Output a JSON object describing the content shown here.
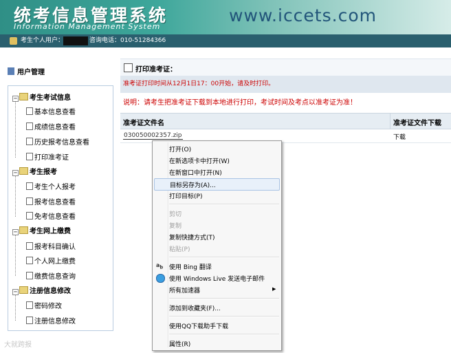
{
  "banner": {
    "title": "统考信息管理系统",
    "subtitle": "Information Management System",
    "url": "www.iccets.com"
  },
  "infobar": {
    "user_label": "考生个人用户：",
    "phone_label": "咨询电话：010-51284366"
  },
  "sidebar": {
    "title": "用户管理",
    "groups": [
      {
        "label": "考生考试信息",
        "items": [
          "基本信息查看",
          "成绩信息查看",
          "历史报考信息查看",
          "打印准考证"
        ]
      },
      {
        "label": "考生报考",
        "items": [
          "考生个人报考",
          "报考信息查看",
          "免考信息查看"
        ]
      },
      {
        "label": "考生网上缴费",
        "items": [
          "报考科目确认",
          "个人网上缴费",
          "缴费信息查询"
        ]
      },
      {
        "label": "注册信息修改",
        "items": [
          "密码修改",
          "注册信息修改"
        ]
      }
    ]
  },
  "main": {
    "title": "打印准考证：",
    "notice": "准考证打印时间从12月1日17：00开始，请及时打印。",
    "explain": "说明：请考生把准考证下载到本地进行打印，考试时间及考点以准考证为准！",
    "table": {
      "headers": [
        "准考证文件名",
        "准考证文件下载"
      ],
      "rows": [
        {
          "file": "030050002357.zip",
          "download": "下载"
        }
      ]
    }
  },
  "context_menu": {
    "items": [
      {
        "label": "打开(O)"
      },
      {
        "label": "在新选项卡中打开(W)"
      },
      {
        "label": "在新窗口中打开(N)"
      },
      {
        "label": "目标另存为(A)..."
      },
      {
        "label": "打印目标(P)"
      },
      {
        "label": "剪切"
      },
      {
        "label": "复制"
      },
      {
        "label": "复制快捷方式(T)"
      },
      {
        "label": "粘贴(P)"
      },
      {
        "label": "使用 Bing 翻译"
      },
      {
        "label": "使用 Windows Live 发送电子邮件"
      },
      {
        "label": "所有加速器"
      },
      {
        "label": "添加到收藏夹(F)..."
      },
      {
        "label": "使用QQ下载助手下载"
      },
      {
        "label": "属性(R)"
      }
    ],
    "highlighted": "目标另存为(A)..."
  },
  "watermark": "大就跨报"
}
